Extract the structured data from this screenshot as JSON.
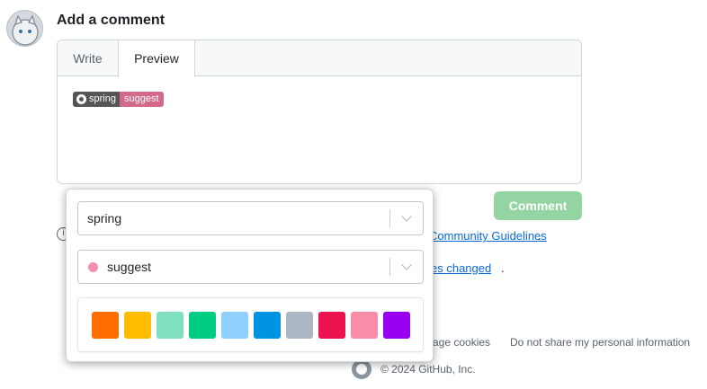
{
  "comment": {
    "title": "Add a comment",
    "tabs": [
      "Write",
      "Preview"
    ],
    "active_tab": "Preview",
    "badge": {
      "left": "spring",
      "right": "suggest",
      "right_color": "#d46a8a"
    },
    "submit_label": "Comment"
  },
  "notes": {
    "guidelines_link": "Community Guidelines",
    "guidelines_suffix": ".",
    "changes_link": "es changed",
    "changes_suffix": "."
  },
  "footer": {
    "manage_cookies": "age cookies",
    "do_not_share": "Do not share my personal information",
    "copyright": "© 2024 GitHub, Inc."
  },
  "popup": {
    "project_select": {
      "value": "spring"
    },
    "label_select": {
      "value": "suggest",
      "dot_color": "#f48fb1"
    },
    "colors": [
      "#ff6d00",
      "#ffbc00",
      "#80dfbc",
      "#00cc83",
      "#8fd1fe",
      "#0093e2",
      "#abb8c3",
      "#ec1250",
      "#f78da7",
      "#9900ef"
    ]
  }
}
